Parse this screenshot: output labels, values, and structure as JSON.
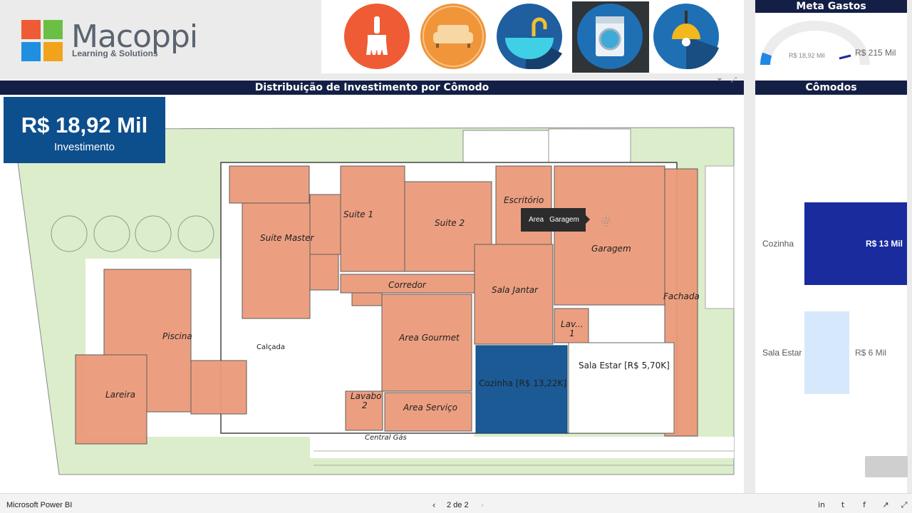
{
  "brand": {
    "name": "Macoppi",
    "tagline": "Learning & Solutions"
  },
  "categories": [
    {
      "icon": "paint-brush-icon",
      "bg": "#ef5b34"
    },
    {
      "icon": "sofa-icon",
      "bg": "#f0953a"
    },
    {
      "icon": "sink-faucet-icon",
      "bg": "#1f6fb5"
    },
    {
      "icon": "washing-machine-icon",
      "bg": "#1f6fb5"
    },
    {
      "icon": "ceiling-lamp-icon",
      "bg": "#1f6fb5"
    }
  ],
  "meta_gastos": {
    "title": "Meta Gastos",
    "current_label": "R$ 18,92 Mil",
    "target_label": "R$ 215 Mil",
    "progress": 0.088
  },
  "main_title": "Distribuição de Investimento por Cômodo",
  "kpi": {
    "value": "R$ 18,92 Mil",
    "label": "Investimento"
  },
  "rooms": {
    "suite1": "Suite 1",
    "suite2": "Suite 2",
    "suite_master": "Suite Master",
    "escritorio": "Escritório",
    "garagem": "Garagem",
    "corredor": "Corredor",
    "sala_jantar": "Sala Jantar",
    "piscina": "Piscina",
    "calcada": "Calçada",
    "area_gourmet": "Area Gourmet",
    "fachada": "Fachada",
    "lav1": "Lav...",
    "lav1b": "1",
    "sala_estar": "Sala Estar [R$ 5,70K]",
    "cozinha": "Cozinha [R$ 13,22K]",
    "lareira": "Lareira",
    "lavabo2": "Lavabo",
    "lavabo2b": "2",
    "area_servico": "Area Serviço",
    "central_gas": "Central Gás"
  },
  "tooltip": {
    "key": "Area",
    "value": "Garagem"
  },
  "comodos": {
    "title": "Cômodos",
    "chart_data": {
      "type": "bar",
      "categories": [
        "Cozinha",
        "Sala Estar"
      ],
      "values": [
        13.22,
        5.7
      ],
      "data_labels": [
        "R$ 13 Mil",
        "R$ 6 Mil"
      ],
      "colors": [
        "#1a2b9e",
        "#d6e8fb"
      ]
    }
  },
  "footer": {
    "brand": "Microsoft Power BI",
    "page": "2 de 2"
  }
}
